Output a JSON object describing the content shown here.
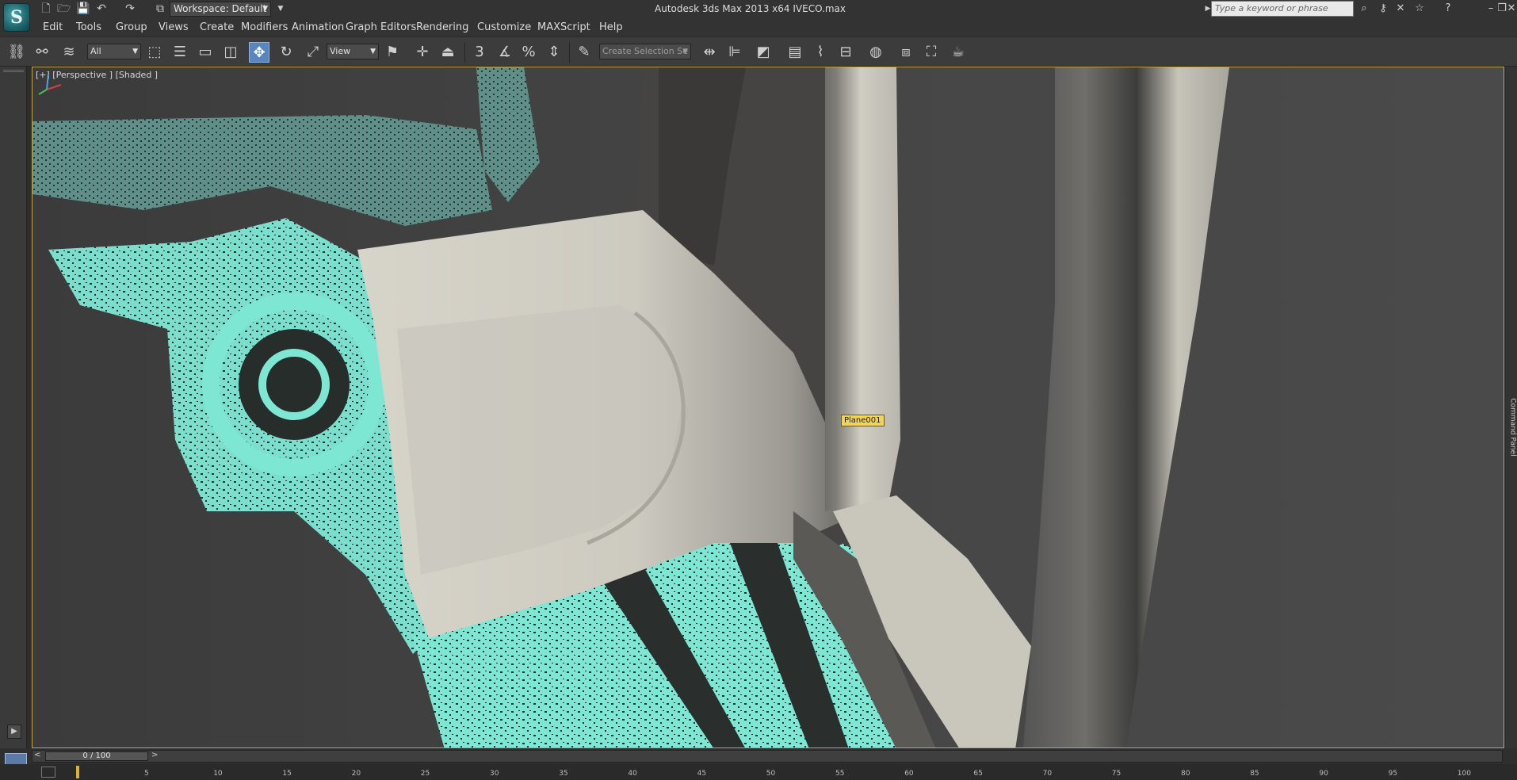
{
  "app": {
    "logo_letter": "S",
    "window_title": "Autodesk 3ds Max  2013 x64      IVECO.max",
    "workspace": "Workspace: Default",
    "search_placeholder": "Type a keyword or phrase"
  },
  "menu": [
    "Edit",
    "Tools",
    "Group",
    "Views",
    "Create",
    "Modifiers",
    "Animation",
    "Graph Editors",
    "Rendering",
    "Customize",
    "MAXScript",
    "Help"
  ],
  "toolbar": {
    "selection_filter": "All",
    "reference_coord": "View",
    "snap_angle_label": "3",
    "percent_snap_label": "%",
    "named_selection_placeholder": "Create Selection Se"
  },
  "viewport": {
    "label": "[+] [Perspective ] [Shaded ]",
    "selected_object": "Plane001",
    "colors": {
      "scan_mesh": "#7ee7d4",
      "surface": "#d9d6cc",
      "background": "#404040",
      "border_active": "#c2a64a"
    }
  },
  "command_panel_label": "Command Panel",
  "timeline": {
    "frame_display": "0 / 100",
    "prev": "<",
    "next": ">",
    "ticks": [
      "5",
      "10",
      "15",
      "20",
      "25",
      "30",
      "35",
      "40",
      "45",
      "50",
      "55",
      "60",
      "65",
      "70",
      "75",
      "80",
      "85",
      "90",
      "95",
      "100"
    ]
  },
  "icons": {
    "new": "new-file-icon",
    "open": "open-folder-icon",
    "save": "save-icon",
    "undo": "undo-icon",
    "redo": "redo-icon",
    "project": "project-folder-icon",
    "help": "help-icon",
    "binoculars": "binoculars-icon",
    "key": "key-icon",
    "star": "star-icon",
    "minimize": "minimize-icon",
    "restore": "restore-icon",
    "close": "close-icon"
  }
}
